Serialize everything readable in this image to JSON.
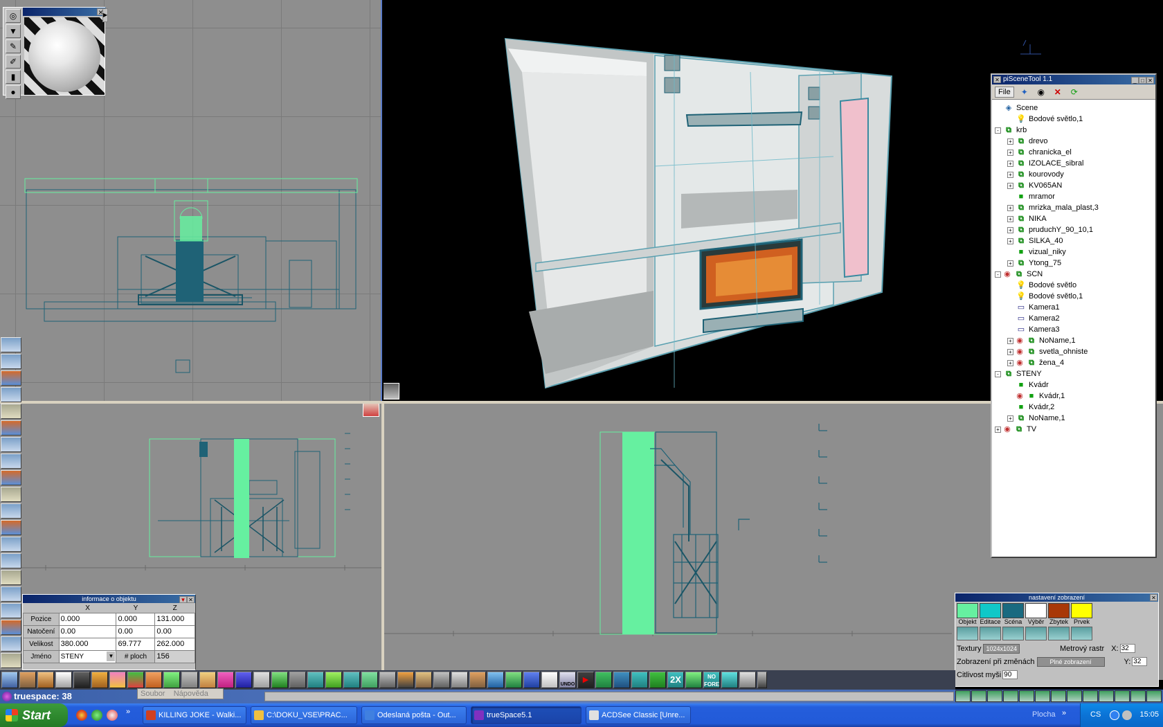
{
  "app": {
    "status_text": "truespace: 38"
  },
  "object_info": {
    "title": "informace o objektu",
    "columns": [
      "X",
      "Y",
      "Z"
    ],
    "rows": [
      {
        "label": "Pozice",
        "values": [
          "0.000",
          "0.000",
          "131.000"
        ]
      },
      {
        "label": "Natočení",
        "values": [
          "0.00",
          "0.00",
          "0.00"
        ]
      },
      {
        "label": "Velikost",
        "values": [
          "380.000",
          "69.777",
          "262.000"
        ]
      }
    ],
    "name_label": "Jméno",
    "name_value": "STENY",
    "faces_label": "# ploch",
    "faces_value": "156"
  },
  "scene_tool": {
    "title": "piSceneTool 1.1",
    "menu_file": "File",
    "tree": [
      {
        "label": "Scene",
        "depth": 0,
        "exp": "",
        "icon": "scene"
      },
      {
        "label": "Bodové světlo,1",
        "depth": 1,
        "exp": "",
        "icon": "light"
      },
      {
        "label": "krb",
        "depth": 0,
        "exp": "-",
        "icon": "group"
      },
      {
        "label": "drevo",
        "depth": 1,
        "exp": "+",
        "icon": "group"
      },
      {
        "label": "chranicka_el",
        "depth": 1,
        "exp": "+",
        "icon": "group"
      },
      {
        "label": "IZOLACE_sibral",
        "depth": 1,
        "exp": "+",
        "icon": "group"
      },
      {
        "label": "kourovody",
        "depth": 1,
        "exp": "+",
        "icon": "group"
      },
      {
        "label": "KV065AN",
        "depth": 1,
        "exp": "+",
        "icon": "group"
      },
      {
        "label": "mramor",
        "depth": 1,
        "exp": "",
        "icon": "obj"
      },
      {
        "label": "mrizka_mala_plast,3",
        "depth": 1,
        "exp": "+",
        "icon": "group"
      },
      {
        "label": "NIKA",
        "depth": 1,
        "exp": "+",
        "icon": "group"
      },
      {
        "label": "pruduchY_90_10,1",
        "depth": 1,
        "exp": "+",
        "icon": "group"
      },
      {
        "label": "SILKA_40",
        "depth": 1,
        "exp": "+",
        "icon": "group"
      },
      {
        "label": "vizual_niky",
        "depth": 1,
        "exp": "",
        "icon": "obj"
      },
      {
        "label": "Ytong_75",
        "depth": 1,
        "exp": "+",
        "icon": "group"
      },
      {
        "label": "SCN",
        "depth": 0,
        "exp": "-",
        "icon": "eye-group"
      },
      {
        "label": "Bodové světlo",
        "depth": 1,
        "exp": "",
        "icon": "light"
      },
      {
        "label": "Bodové světlo,1",
        "depth": 1,
        "exp": "",
        "icon": "light"
      },
      {
        "label": "Kamera1",
        "depth": 1,
        "exp": "",
        "icon": "cam"
      },
      {
        "label": "Kamera2",
        "depth": 1,
        "exp": "",
        "icon": "cam"
      },
      {
        "label": "Kamera3",
        "depth": 1,
        "exp": "",
        "icon": "cam"
      },
      {
        "label": "NoName,1",
        "depth": 1,
        "exp": "+",
        "icon": "eye-group"
      },
      {
        "label": "svetla_ohniste",
        "depth": 1,
        "exp": "+",
        "icon": "eye-group"
      },
      {
        "label": "žena_4",
        "depth": 1,
        "exp": "+",
        "icon": "eye-group"
      },
      {
        "label": "STENY",
        "depth": 0,
        "exp": "-",
        "icon": "group"
      },
      {
        "label": "Kvádr",
        "depth": 1,
        "exp": "",
        "icon": "obj"
      },
      {
        "label": "Kvádr,1",
        "depth": 1,
        "exp": "",
        "icon": "eye-obj"
      },
      {
        "label": "Kvádr,2",
        "depth": 1,
        "exp": "",
        "icon": "obj"
      },
      {
        "label": "NoName,1",
        "depth": 1,
        "exp": "+",
        "icon": "group"
      },
      {
        "label": "TV",
        "depth": 0,
        "exp": "+",
        "icon": "eye-group"
      }
    ]
  },
  "display_settings": {
    "title": "nastavení zobrazení",
    "swatches": [
      {
        "label": "Objekt",
        "color": "#66f0a0"
      },
      {
        "label": "Editace",
        "color": "#10c8c8"
      },
      {
        "label": "Scéna",
        "color": "#1a6a80"
      },
      {
        "label": "Výběr",
        "color": "#ffffff"
      },
      {
        "label": "Zbytek",
        "color": "#a83808"
      },
      {
        "label": "Prvek",
        "color": "#ffff00"
      }
    ],
    "textures_label": "Textury",
    "textures_value": "1024x1024",
    "grid_label": "Metrový rastr",
    "grid_x_label": "X:",
    "grid_x": "32",
    "redraw_label": "Zobrazení při změnách",
    "redraw_value": "Plné zobrazení",
    "grid_y_label": "Y:",
    "grid_y": "32",
    "mouse_label": "Citlivost myši",
    "mouse_value": "90"
  },
  "status_menu": {
    "file": "Soubor",
    "help": "Nápověda"
  },
  "bottom_toolbar": {
    "undo_label": "UNDO",
    "zoom_label": "2X",
    "nofore_label": "NO FORE"
  },
  "taskbar": {
    "start_label": "Start",
    "tasks": [
      {
        "label": "KILLING JOKE - Walki...",
        "icon_color": "#d04020",
        "active": false
      },
      {
        "label": "C:\\DOKU_VSE\\PRAC...",
        "icon_color": "#f0c040",
        "active": false
      },
      {
        "label": "Odeslaná pošta - Out...",
        "icon_color": "#4080e0",
        "active": false
      },
      {
        "label": "trueSpace5.1",
        "icon_color": "#8030c0",
        "active": true
      },
      {
        "label": "ACDSee Classic [Unre...",
        "icon_color": "#e0e0e0",
        "active": false
      }
    ],
    "desktop_label": "Plocha",
    "language": "CS",
    "clock": "15:05"
  }
}
